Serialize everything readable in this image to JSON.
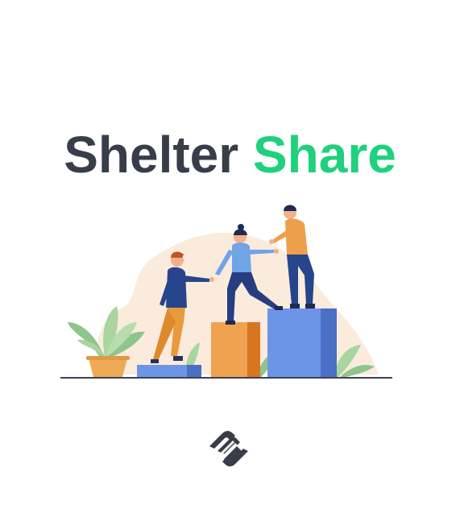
{
  "app": {
    "title_part1": "Shelter",
    "title_part2": "Share",
    "colors": {
      "title_dark": "#373d49",
      "title_accent": "#1fd17c",
      "background": "#ffffff"
    },
    "illustration": "people-helping-each-other-climb-steps",
    "logo_icon": "handshake-icon"
  }
}
